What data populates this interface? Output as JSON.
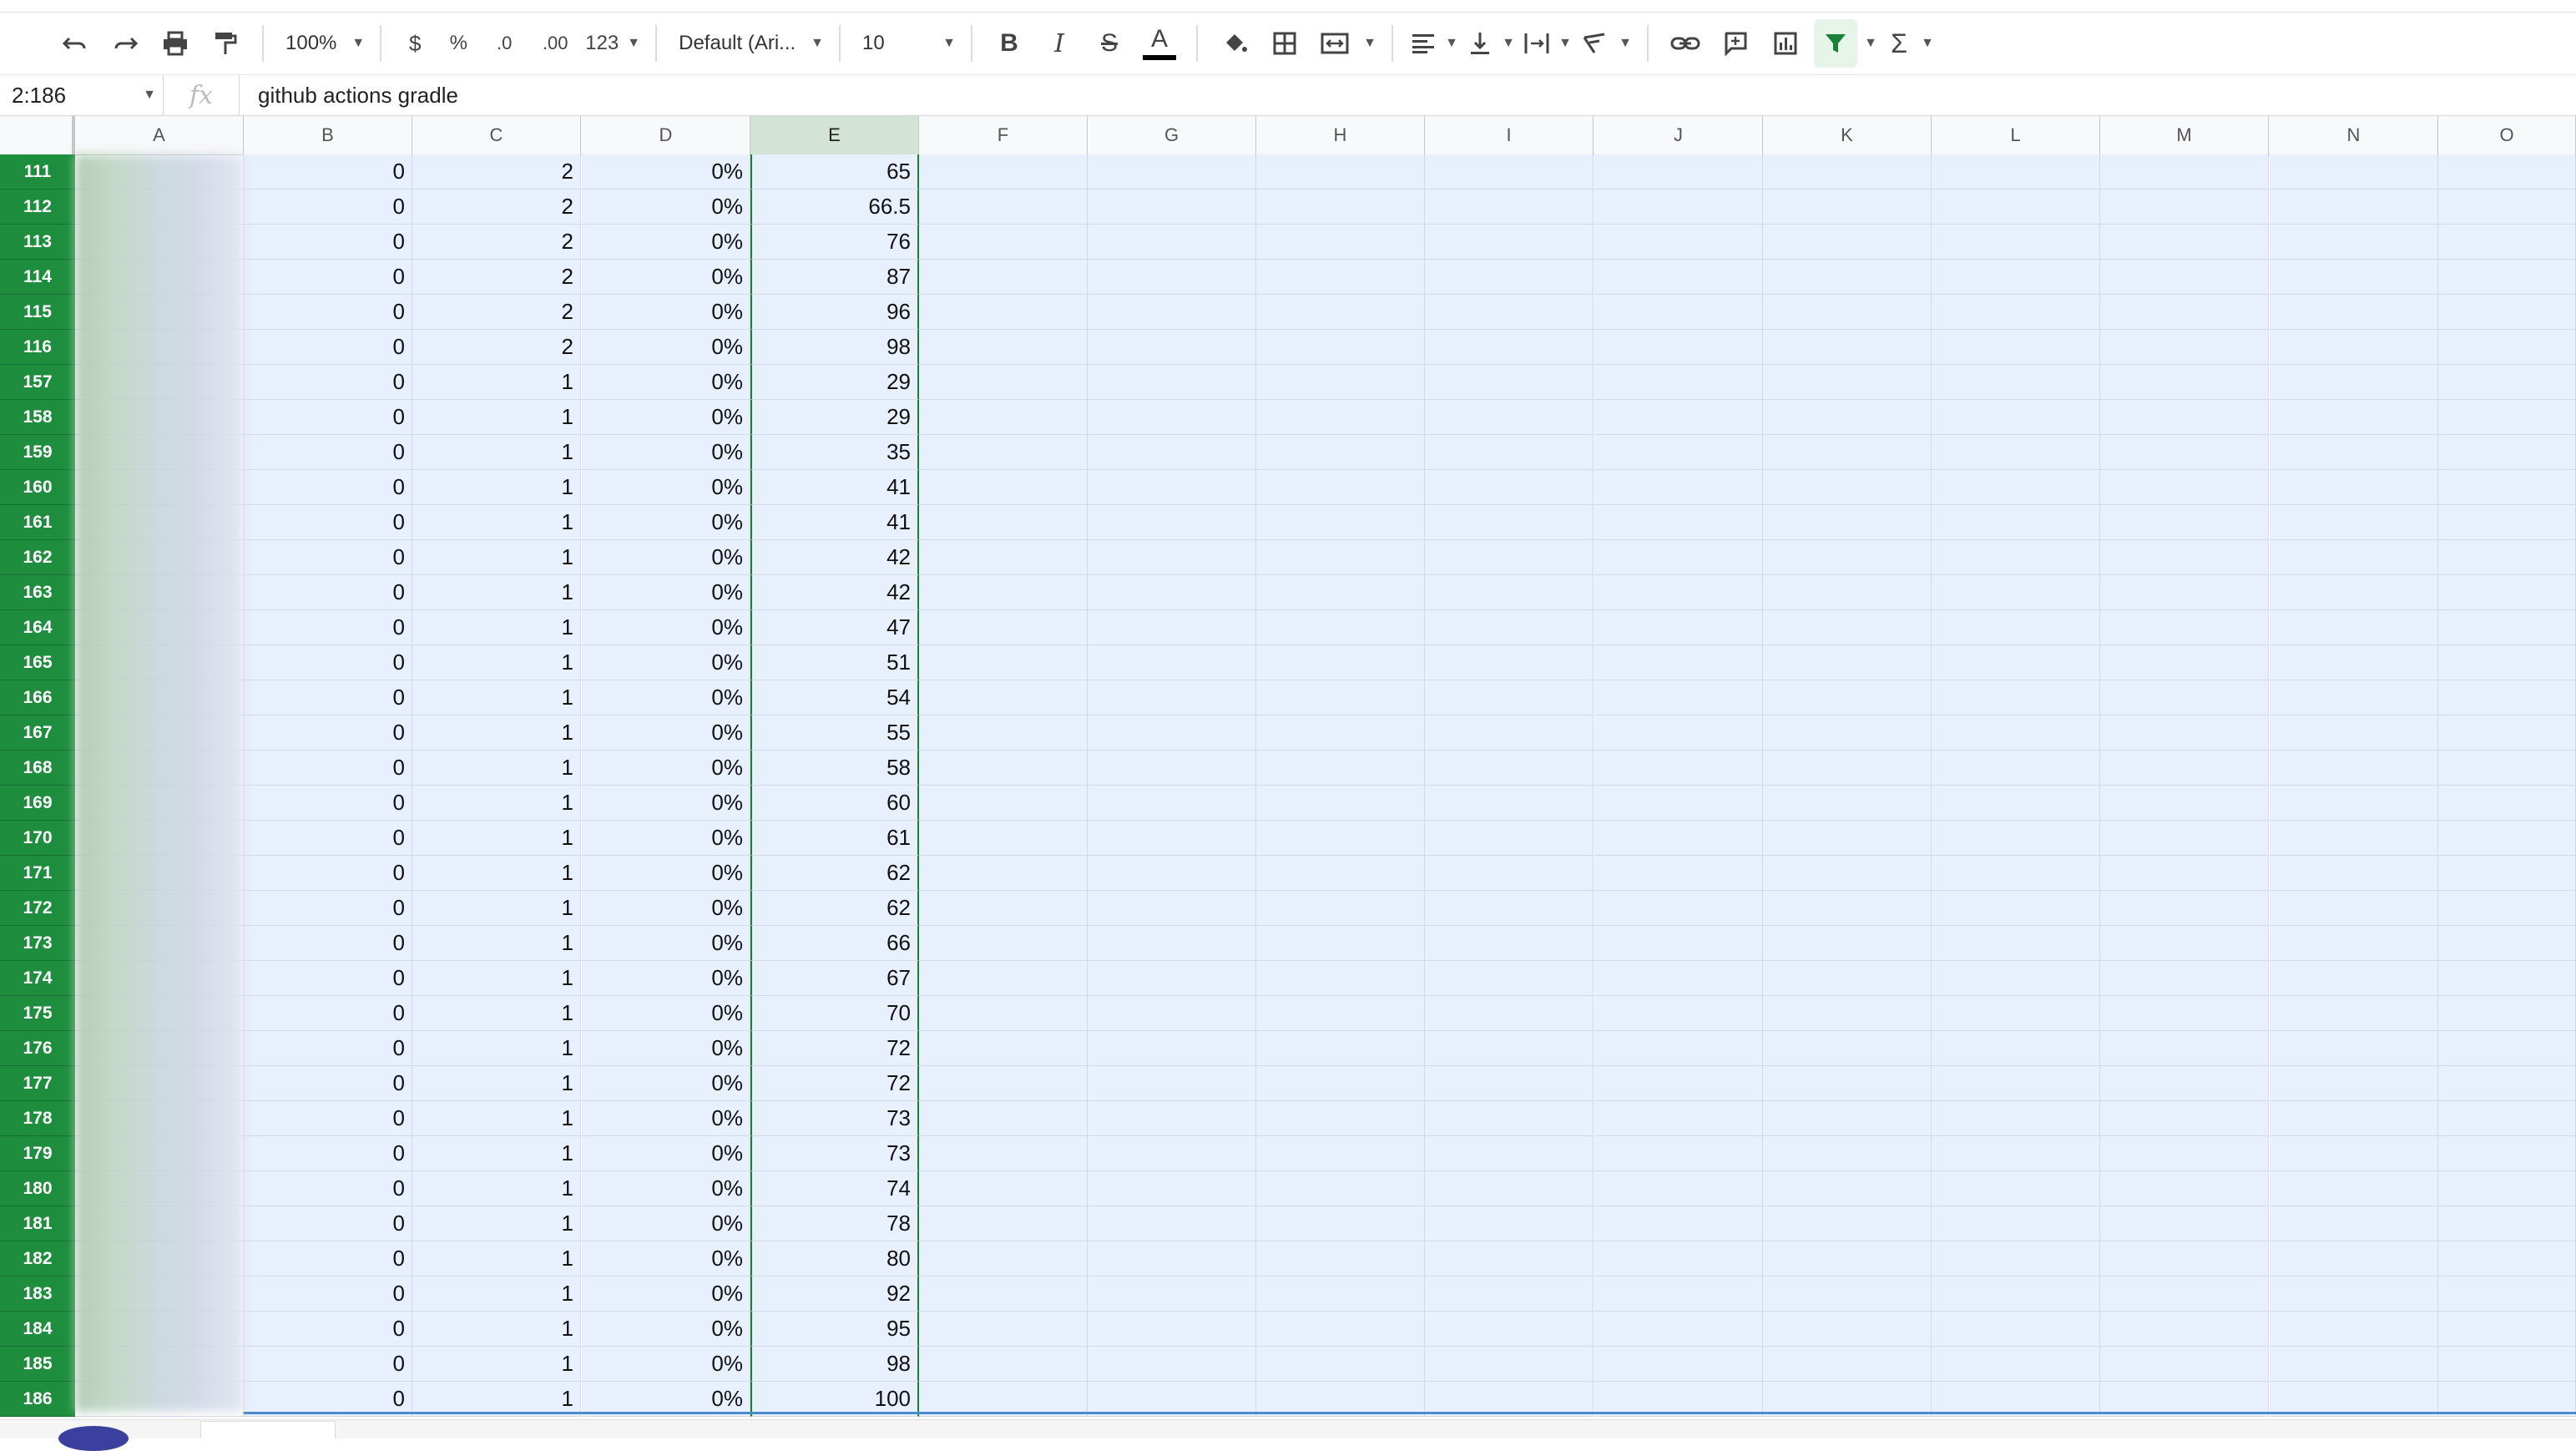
{
  "toolbar": {
    "zoom": "100%",
    "currency": "$",
    "percent": "%",
    "decrease_decimals": ".0",
    "increase_decimals": ".00",
    "more_formats": "123",
    "font": "Default (Ari...",
    "font_size": "10",
    "icons": [
      "undo-icon",
      "redo-icon",
      "print-icon",
      "paint-format-icon",
      "bold-icon",
      "italic-icon",
      "strikethrough-icon",
      "text-color-icon",
      "fill-color-icon",
      "borders-icon",
      "merge-cells-icon",
      "horizontal-align-icon",
      "vertical-align-icon",
      "text-wrap-icon",
      "text-rotate-icon",
      "insert-link-icon",
      "insert-comment-icon",
      "insert-chart-icon",
      "filter-icon",
      "functions-icon"
    ],
    "colors": {
      "filter_active": "#188038",
      "text_color_bar": "#000000"
    }
  },
  "formula_bar": {
    "name_box": "2:186",
    "fx_label": "fx",
    "content": "github actions gradle"
  },
  "columns": [
    "A",
    "B",
    "C",
    "D",
    "E",
    "F",
    "G",
    "H",
    "I",
    "J",
    "K",
    "L",
    "M",
    "N",
    "O"
  ],
  "selected_column": "E",
  "rows": [
    {
      "num": "111",
      "b": "0",
      "c": "2",
      "d": "0%",
      "e": "65"
    },
    {
      "num": "112",
      "b": "0",
      "c": "2",
      "d": "0%",
      "e": "66.5"
    },
    {
      "num": "113",
      "b": "0",
      "c": "2",
      "d": "0%",
      "e": "76"
    },
    {
      "num": "114",
      "b": "0",
      "c": "2",
      "d": "0%",
      "e": "87"
    },
    {
      "num": "115",
      "b": "0",
      "c": "2",
      "d": "0%",
      "e": "96"
    },
    {
      "num": "116",
      "b": "0",
      "c": "2",
      "d": "0%",
      "e": "98"
    },
    {
      "num": "157",
      "b": "0",
      "c": "1",
      "d": "0%",
      "e": "29"
    },
    {
      "num": "158",
      "b": "0",
      "c": "1",
      "d": "0%",
      "e": "29"
    },
    {
      "num": "159",
      "b": "0",
      "c": "1",
      "d": "0%",
      "e": "35"
    },
    {
      "num": "160",
      "b": "0",
      "c": "1",
      "d": "0%",
      "e": "41"
    },
    {
      "num": "161",
      "b": "0",
      "c": "1",
      "d": "0%",
      "e": "41"
    },
    {
      "num": "162",
      "b": "0",
      "c": "1",
      "d": "0%",
      "e": "42"
    },
    {
      "num": "163",
      "b": "0",
      "c": "1",
      "d": "0%",
      "e": "42"
    },
    {
      "num": "164",
      "b": "0",
      "c": "1",
      "d": "0%",
      "e": "47"
    },
    {
      "num": "165",
      "b": "0",
      "c": "1",
      "d": "0%",
      "e": "51"
    },
    {
      "num": "166",
      "b": "0",
      "c": "1",
      "d": "0%",
      "e": "54"
    },
    {
      "num": "167",
      "b": "0",
      "c": "1",
      "d": "0%",
      "e": "55"
    },
    {
      "num": "168",
      "b": "0",
      "c": "1",
      "d": "0%",
      "e": "58"
    },
    {
      "num": "169",
      "b": "0",
      "c": "1",
      "d": "0%",
      "e": "60"
    },
    {
      "num": "170",
      "b": "0",
      "c": "1",
      "d": "0%",
      "e": "61"
    },
    {
      "num": "171",
      "b": "0",
      "c": "1",
      "d": "0%",
      "e": "62"
    },
    {
      "num": "172",
      "b": "0",
      "c": "1",
      "d": "0%",
      "e": "62"
    },
    {
      "num": "173",
      "b": "0",
      "c": "1",
      "d": "0%",
      "e": "66"
    },
    {
      "num": "174",
      "b": "0",
      "c": "1",
      "d": "0%",
      "e": "67"
    },
    {
      "num": "175",
      "b": "0",
      "c": "1",
      "d": "0%",
      "e": "70"
    },
    {
      "num": "176",
      "b": "0",
      "c": "1",
      "d": "0%",
      "e": "72"
    },
    {
      "num": "177",
      "b": "0",
      "c": "1",
      "d": "0%",
      "e": "72"
    },
    {
      "num": "178",
      "b": "0",
      "c": "1",
      "d": "0%",
      "e": "73"
    },
    {
      "num": "179",
      "b": "0",
      "c": "1",
      "d": "0%",
      "e": "73"
    },
    {
      "num": "180",
      "b": "0",
      "c": "1",
      "d": "0%",
      "e": "74"
    },
    {
      "num": "181",
      "b": "0",
      "c": "1",
      "d": "0%",
      "e": "78"
    },
    {
      "num": "182",
      "b": "0",
      "c": "1",
      "d": "0%",
      "e": "80"
    },
    {
      "num": "183",
      "b": "0",
      "c": "1",
      "d": "0%",
      "e": "92"
    },
    {
      "num": "184",
      "b": "0",
      "c": "1",
      "d": "0%",
      "e": "95"
    },
    {
      "num": "185",
      "b": "0",
      "c": "1",
      "d": "0%",
      "e": "98"
    },
    {
      "num": "186",
      "b": "0",
      "c": "1",
      "d": "0%",
      "e": "100"
    }
  ]
}
